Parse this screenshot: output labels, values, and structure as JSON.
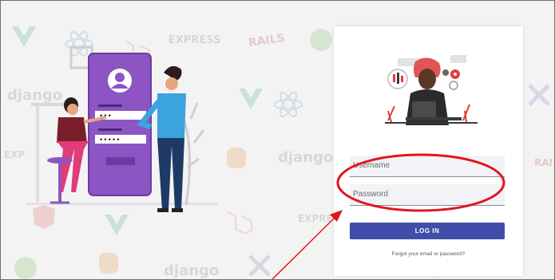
{
  "background": {
    "words": [
      "EXPRESS",
      "RAILS",
      "django",
      "django",
      "django",
      "EXPRESS",
      "EXP",
      "RAI"
    ]
  },
  "login": {
    "username_placeholder": "Username",
    "password_placeholder": "Password",
    "login_label": "LOG IN",
    "forgot_link": "Forgot your email or password?"
  },
  "annotation": {
    "color": "#e0161e"
  },
  "colors": {
    "accent": "#3f4ea8",
    "illustration_purple": "#8d55c4"
  }
}
